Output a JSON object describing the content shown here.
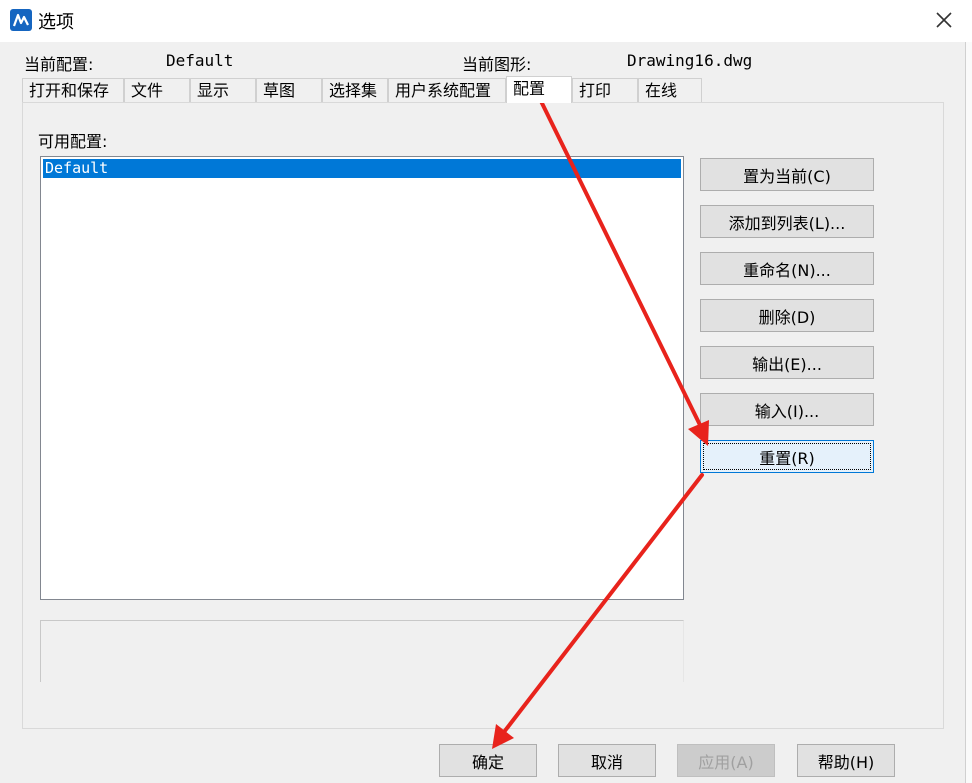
{
  "window": {
    "title": "选项"
  },
  "header": {
    "current_profile_label": "当前配置:",
    "current_profile_value": "Default",
    "current_drawing_label": "当前图形:",
    "current_drawing_value": "Drawing16.dwg"
  },
  "tabs": [
    {
      "label": "打开和保存"
    },
    {
      "label": "文件"
    },
    {
      "label": "显示"
    },
    {
      "label": "草图"
    },
    {
      "label": "选择集"
    },
    {
      "label": "用户系统配置"
    },
    {
      "label": "配置",
      "active": true
    },
    {
      "label": "打印"
    },
    {
      "label": "在线"
    }
  ],
  "profiles": {
    "label": "可用配置:",
    "items": [
      {
        "label": "Default",
        "selected": true
      }
    ]
  },
  "side_buttons": [
    {
      "label": "置为当前(C)"
    },
    {
      "label": "添加到列表(L)..."
    },
    {
      "label": "重命名(N)..."
    },
    {
      "label": "删除(D)"
    },
    {
      "label": "输出(E)..."
    },
    {
      "label": "输入(I)..."
    },
    {
      "label": "重置(R)",
      "focused": true
    }
  ],
  "bottom_buttons": [
    {
      "label": "确定"
    },
    {
      "label": "取消"
    },
    {
      "label": "应用(A)",
      "disabled": true
    },
    {
      "label": "帮助(H)"
    }
  ],
  "colors": {
    "selection": "#0078d7",
    "annotation_arrow": "#e8231c",
    "focused_button_bg": "#e5f1fb"
  },
  "icons": {
    "app": "app-logo-icon",
    "close": "close-icon"
  }
}
